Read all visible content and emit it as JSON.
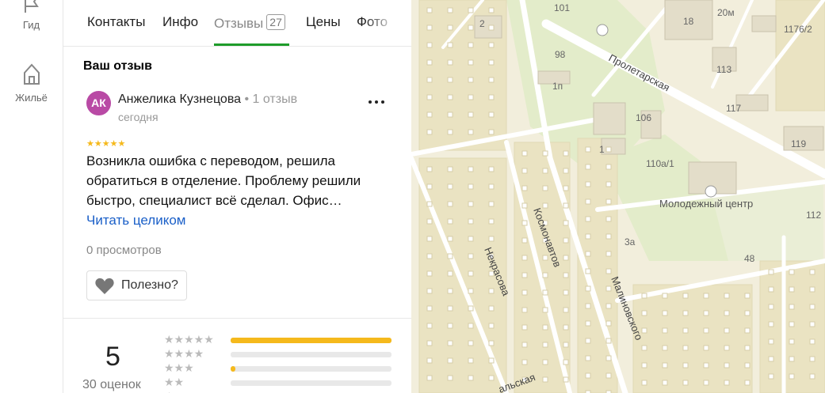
{
  "rail": {
    "items": [
      {
        "label": "Гид",
        "icon": "flag-icon"
      },
      {
        "label": "Жильё",
        "icon": "house-icon"
      }
    ]
  },
  "tabs": [
    {
      "label": "Контакты"
    },
    {
      "label": "Инфо"
    },
    {
      "label": "Отзывы",
      "count": "27",
      "active": true
    },
    {
      "label": "Цены"
    },
    {
      "label": "Фото"
    }
  ],
  "review_section": {
    "title": "Ваш отзыв",
    "author": {
      "initials": "АК",
      "name": "Анжелика Кузнецова",
      "meta": " • 1 отзыв",
      "date": "сегодня",
      "avatar_color": "#b94aa5"
    },
    "stars": "★★★★★",
    "rating": 5,
    "text": "Возникла ошибка с переводом, решила обратиться в отделение. Проблему решили быстро, специалист всё сделал. Офис…",
    "read_more": "Читать целиком",
    "views": "0 просмотров",
    "helpful": "Полезно?"
  },
  "summary": {
    "rating": "5",
    "count": "30 оценок",
    "rows": [
      {
        "stars": "★★★★★",
        "fraction": 1.0
      },
      {
        "stars": "★★★★",
        "fraction": 0.0
      },
      {
        "stars": "★★★",
        "fraction": 0.03
      },
      {
        "stars": "★★",
        "fraction": 0.0
      },
      {
        "stars": "★",
        "fraction": 0.0
      }
    ]
  },
  "map": {
    "streets": [
      "Пролетарская",
      "Некрасова",
      "Космонавтов",
      "Малиновского",
      "альская"
    ],
    "places": [
      "Молодежный центр"
    ],
    "house_numbers": [
      "101",
      "2",
      "18",
      "20м",
      "1176/2",
      "98",
      "1п",
      "113",
      "106",
      "117",
      "119",
      "1",
      "110а/1",
      "112",
      "3а",
      "48"
    ]
  },
  "colors": {
    "accent_green": "#1e9c2a",
    "star": "#f5b91c",
    "link": "#1a5fc8"
  }
}
